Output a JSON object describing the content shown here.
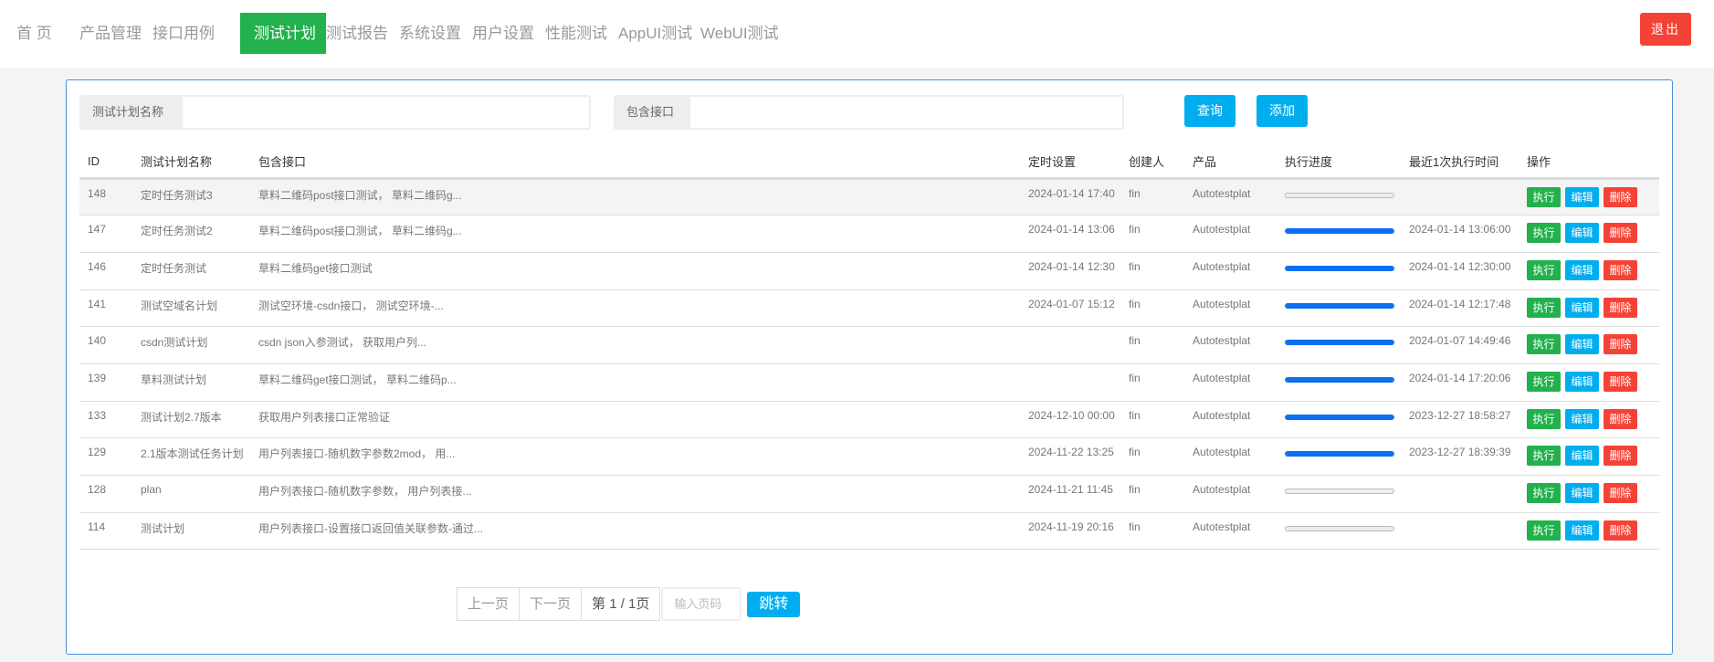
{
  "nav": {
    "items": [
      "首 页",
      "产品管理",
      "接口用例",
      "测试计划",
      "测试报告",
      "系统设置",
      "用户设置",
      "性能测试",
      "AppUI测试",
      "WebUI测试"
    ],
    "active_index": 3,
    "logout": "退出"
  },
  "search": {
    "plan_name_label": "测试计划名称",
    "plan_name_value": "",
    "interface_label": "包含接口",
    "interface_value": "",
    "query_button": "查询",
    "add_button": "添加"
  },
  "table": {
    "headers": [
      "ID",
      "测试计划名称",
      "包含接口",
      "定时设置",
      "创建人",
      "产品",
      "执行进度",
      "最近1次执行时间",
      "操作"
    ],
    "actions": {
      "run": "执行",
      "edit": "编辑",
      "delete": "删除"
    },
    "rows": [
      {
        "id": "148",
        "name": "定时任务测试3",
        "interfaces": "草料二维码post接口测试， 草料二维码g...",
        "schedule": "2024-01-14 17:40",
        "creator": "fin",
        "product": "Autotestplat",
        "progress": 0,
        "last_run": ""
      },
      {
        "id": "147",
        "name": "定时任务测试2",
        "interfaces": "草料二维码post接口测试， 草料二维码g...",
        "schedule": "2024-01-14 13:06",
        "creator": "fin",
        "product": "Autotestplat",
        "progress": 100,
        "last_run": "2024-01-14 13:06:00"
      },
      {
        "id": "146",
        "name": "定时任务测试",
        "interfaces": "草料二维码get接口测试",
        "schedule": "2024-01-14 12:30",
        "creator": "fin",
        "product": "Autotestplat",
        "progress": 100,
        "last_run": "2024-01-14 12:30:00"
      },
      {
        "id": "141",
        "name": "测试空域名计划",
        "interfaces": "测试空环境-csdn接口， 测试空环境-...",
        "schedule": "2024-01-07 15:12",
        "creator": "fin",
        "product": "Autotestplat",
        "progress": 100,
        "last_run": "2024-01-14 12:17:48"
      },
      {
        "id": "140",
        "name": "csdn测试计划",
        "interfaces": "csdn json入参测试， 获取用户列...",
        "schedule": "",
        "creator": "fin",
        "product": "Autotestplat",
        "progress": 100,
        "last_run": "2024-01-07 14:49:46"
      },
      {
        "id": "139",
        "name": "草料测试计划",
        "interfaces": "草料二维码get接口测试， 草料二维码p...",
        "schedule": "",
        "creator": "fin",
        "product": "Autotestplat",
        "progress": 100,
        "last_run": "2024-01-14 17:20:06"
      },
      {
        "id": "133",
        "name": "测试计划2.7版本",
        "interfaces": "获取用户列表接口正常验证",
        "schedule": "2024-12-10 00:00",
        "creator": "fin",
        "product": "Autotestplat",
        "progress": 100,
        "last_run": "2023-12-27 18:58:27"
      },
      {
        "id": "129",
        "name": "2.1版本测试任务计划",
        "interfaces": "用户列表接口-随机数字参数2mod， 用...",
        "schedule": "2024-11-22 13:25",
        "creator": "fin",
        "product": "Autotestplat",
        "progress": 100,
        "last_run": "2023-12-27 18:39:39"
      },
      {
        "id": "128",
        "name": "plan",
        "interfaces": "用户列表接口-随机数字参数， 用户列表接...",
        "schedule": "2024-11-21 11:45",
        "creator": "fin",
        "product": "Autotestplat",
        "progress": 0,
        "last_run": ""
      },
      {
        "id": "114",
        "name": "测试计划",
        "interfaces": "用户列表接口-设置接口返回值关联参数-通过...",
        "schedule": "2024-11-19 20:16",
        "creator": "fin",
        "product": "Autotestplat",
        "progress": 0,
        "last_run": ""
      }
    ]
  },
  "pager": {
    "prev": "上一页",
    "next": "下一页",
    "current": "第 1 / 1页",
    "input_placeholder": "输入页码",
    "jump": "跳转"
  }
}
